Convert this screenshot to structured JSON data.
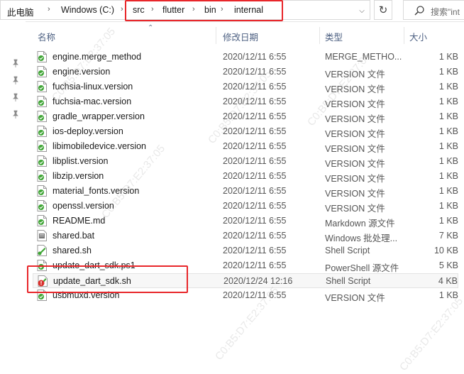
{
  "breadcrumb": {
    "items": [
      "此电脑",
      "Windows (C:)",
      "src",
      "flutter",
      "bin",
      "internal"
    ]
  },
  "search": {
    "placeholder": "搜索\"int"
  },
  "columns": {
    "name": "名称",
    "date": "修改日期",
    "type": "类型",
    "size": "大小"
  },
  "files": [
    {
      "name": "engine.merge_method",
      "date": "2020/12/11 6:55",
      "type": "MERGE_METHO...",
      "size": "1 KB",
      "icon": "version-file-icon"
    },
    {
      "name": "engine.version",
      "date": "2020/12/11 6:55",
      "type": "VERSION 文件",
      "size": "1 KB",
      "icon": "version-file-icon"
    },
    {
      "name": "fuchsia-linux.version",
      "date": "2020/12/11 6:55",
      "type": "VERSION 文件",
      "size": "1 KB",
      "icon": "version-file-icon"
    },
    {
      "name": "fuchsia-mac.version",
      "date": "2020/12/11 6:55",
      "type": "VERSION 文件",
      "size": "1 KB",
      "icon": "version-file-icon"
    },
    {
      "name": "gradle_wrapper.version",
      "date": "2020/12/11 6:55",
      "type": "VERSION 文件",
      "size": "1 KB",
      "icon": "version-file-icon"
    },
    {
      "name": "ios-deploy.version",
      "date": "2020/12/11 6:55",
      "type": "VERSION 文件",
      "size": "1 KB",
      "icon": "version-file-icon"
    },
    {
      "name": "libimobiledevice.version",
      "date": "2020/12/11 6:55",
      "type": "VERSION 文件",
      "size": "1 KB",
      "icon": "version-file-icon"
    },
    {
      "name": "libplist.version",
      "date": "2020/12/11 6:55",
      "type": "VERSION 文件",
      "size": "1 KB",
      "icon": "version-file-icon"
    },
    {
      "name": "libzip.version",
      "date": "2020/12/11 6:55",
      "type": "VERSION 文件",
      "size": "1 KB",
      "icon": "version-file-icon"
    },
    {
      "name": "material_fonts.version",
      "date": "2020/12/11 6:55",
      "type": "VERSION 文件",
      "size": "1 KB",
      "icon": "version-file-icon"
    },
    {
      "name": "openssl.version",
      "date": "2020/12/11 6:55",
      "type": "VERSION 文件",
      "size": "1 KB",
      "icon": "version-file-icon"
    },
    {
      "name": "README.md",
      "date": "2020/12/11 6:55",
      "type": "Markdown 源文件",
      "size": "1 KB",
      "icon": "version-file-icon"
    },
    {
      "name": "shared.bat",
      "date": "2020/12/11 6:55",
      "type": "Windows 批处理...",
      "size": "7 KB",
      "icon": "bat-file-icon"
    },
    {
      "name": "shared.sh",
      "date": "2020/12/11 6:55",
      "type": "Shell Script",
      "size": "10 KB",
      "icon": "shell-file-icon"
    },
    {
      "name": "update_dart_sdk.ps1",
      "date": "2020/12/11 6:55",
      "type": "PowerShell 源文件",
      "size": "5 KB",
      "icon": "version-file-icon"
    },
    {
      "name": "update_dart_sdk.sh",
      "date": "2020/12/24 12:16",
      "type": "Shell Script",
      "size": "4 KB",
      "icon": "modified-shell-file-icon"
    },
    {
      "name": "usbmuxd.version",
      "date": "2020/12/11 6:55",
      "type": "VERSION 文件",
      "size": "1 KB",
      "icon": "version-file-icon"
    }
  ],
  "watermark": "C0:B5:D7:E2:37:05",
  "colors": {
    "highlight": "#e8262a",
    "header_text": "#4d6082",
    "file_icon_green": "#3fa535"
  }
}
